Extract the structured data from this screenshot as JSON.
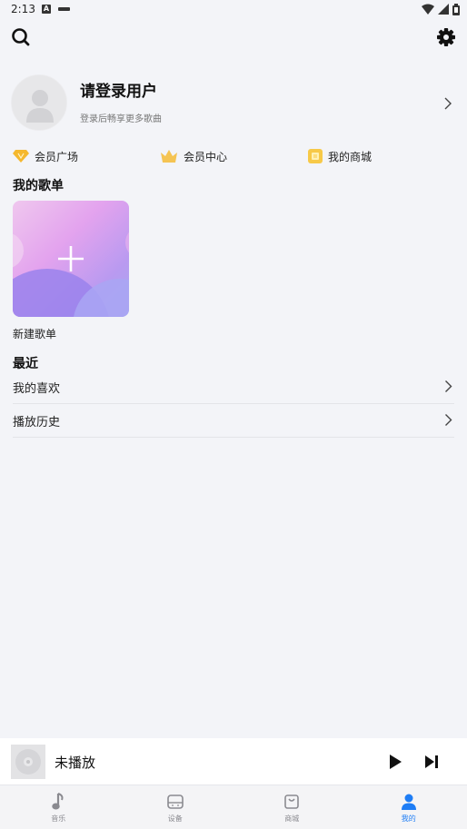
{
  "status_bar": {
    "time": "2:13",
    "notification_icons": [
      "a-icon",
      "dash-icon"
    ],
    "system_icons": [
      "wifi-icon",
      "signal-icon",
      "battery-icon"
    ]
  },
  "header": {
    "left_icon": "search-icon",
    "right_icon": "gear-icon"
  },
  "profile": {
    "name": "请登录用户",
    "subtitle": "登录后畅享更多歌曲"
  },
  "shortcuts": [
    {
      "label": "会员广场",
      "icon": "diamond-icon",
      "color": "#f5b82e"
    },
    {
      "label": "会员中心",
      "icon": "crown-icon",
      "color": "#f5c453"
    },
    {
      "label": "我的商城",
      "icon": "store-icon",
      "color": "#f7c948"
    }
  ],
  "playlists": {
    "title": "我的歌单",
    "new_playlist_label": "新建歌单"
  },
  "recent": {
    "title": "最近",
    "items": [
      {
        "label": "我的喜欢"
      },
      {
        "label": "播放历史"
      }
    ]
  },
  "mini_player": {
    "title": "未播放"
  },
  "tab_bar": {
    "accent_color": "#1e7df5",
    "tabs": [
      {
        "label": "音乐",
        "icon": "music-note-icon",
        "active": false
      },
      {
        "label": "设备",
        "icon": "device-icon",
        "active": false
      },
      {
        "label": "商城",
        "icon": "shopping-bag-icon",
        "active": false
      },
      {
        "label": "我的",
        "icon": "person-icon",
        "active": true
      }
    ]
  }
}
